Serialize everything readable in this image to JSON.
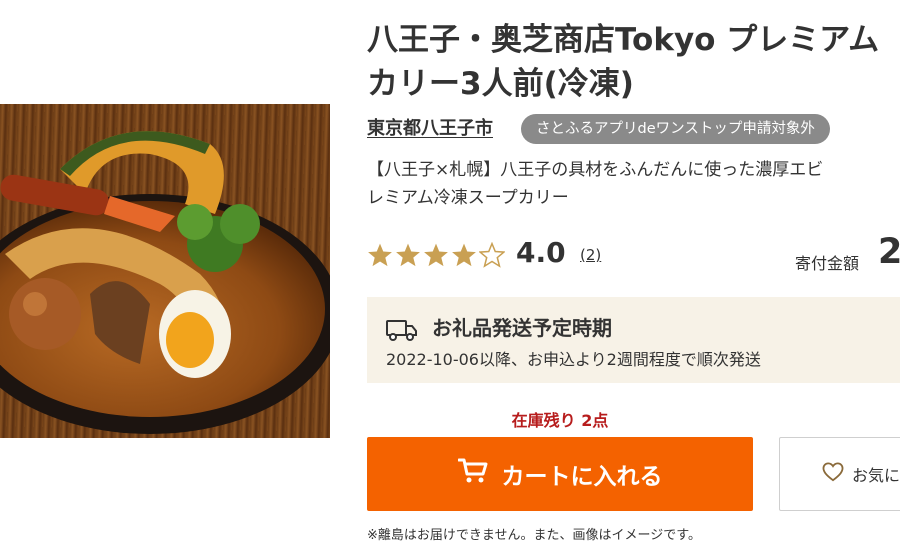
{
  "product": {
    "title_line1": "八王子・奥芝商店Tokyo プレミアム",
    "title_line2": "カリー3人前(冷凍)",
    "municipality": "東京都八王子市",
    "badge": "さとふるアプリdeワンストップ申請対象外",
    "desc_line1": "【八王子×札幌】八王子の具材をふんだんに使った濃厚エビ",
    "desc_line2": "レミアム冷凍スープカリー",
    "image_alt": "スープカリー"
  },
  "rating": {
    "value": "4.0",
    "count": "(2)",
    "stars_filled": 4,
    "stars_total": 5
  },
  "donation": {
    "label": "寄付金額",
    "amount_visible": "2"
  },
  "shipping": {
    "title": "お礼品発送予定時期",
    "text": "2022-10-06以降、お申込より2週間程度で順次発送",
    "icon": "truck-icon"
  },
  "stock": {
    "text": "在庫残り 2点"
  },
  "actions": {
    "cart_label": "カートに入れる",
    "favorite_label": "お気に"
  },
  "note": "※離島はお届けできません。また、画像はイメージです。",
  "colors": {
    "cart_orange": "#f46200",
    "star_gold": "#c9a053",
    "stock_red": "#b71c1c",
    "badge_gray": "#8a8a8a",
    "shipping_bg": "#f7f2e7"
  }
}
